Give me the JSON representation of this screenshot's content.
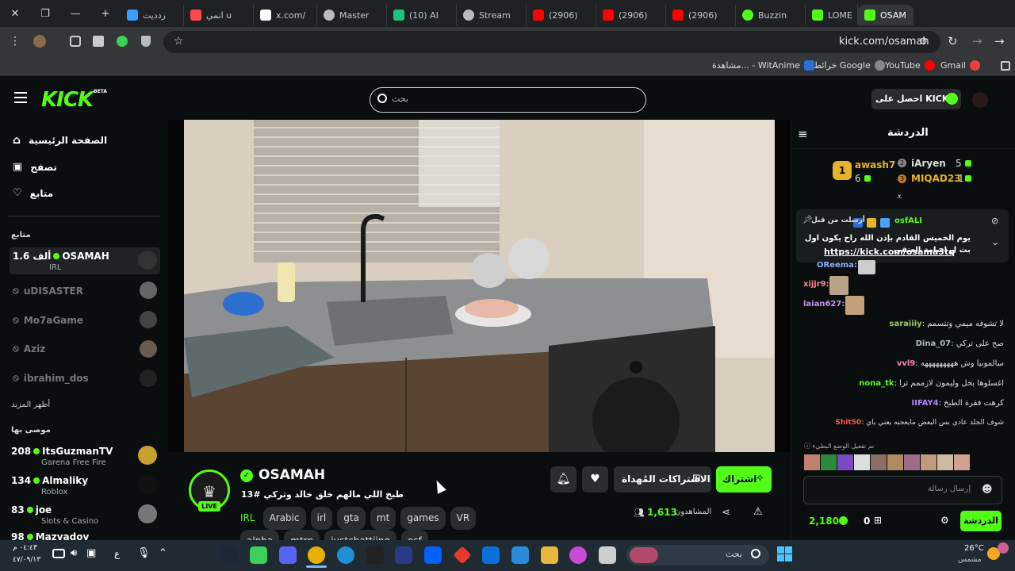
{
  "browser": {
    "tabs": [
      {
        "label": "ردديت",
        "color": "#3aa0ff"
      },
      {
        "label": "انمي u",
        "color": "#ff4a4a"
      },
      {
        "label": "x.com/",
        "color": "#ffffff"
      },
      {
        "label": "Master",
        "color": "#bbbbbb"
      },
      {
        "label": "(10) AI",
        "color": "#19c37d"
      },
      {
        "label": "Stream",
        "color": "#bbbbbb"
      },
      {
        "label": "(2906)",
        "color": "#ff0000"
      },
      {
        "label": "(2906)",
        "color": "#ff0000"
      },
      {
        "label": "(2906)",
        "color": "#ff0000"
      },
      {
        "label": "Buzzin",
        "color": "#53fc18"
      },
      {
        "label": "LOME",
        "color": "#53fc18"
      },
      {
        "label": "OSAM",
        "color": "#53fc18"
      }
    ],
    "url": "kick.com/osamah",
    "bookmarks": [
      {
        "label": "Gmail",
        "color": "#ea4335"
      },
      {
        "label": "YouTube",
        "color": "#ff0000"
      },
      {
        "label": "خرائط Google",
        "color": "#34a853"
      },
      {
        "label": "مشاهدة... - WitAnime",
        "color": "#2b6fd6"
      }
    ]
  },
  "header": {
    "logo": "KICK",
    "beta": "BETA",
    "search_placeholder": "بحث",
    "get_kicks": "احصل على KICKs"
  },
  "sidebar": {
    "nav": [
      {
        "label": "الصفحة الرئيسية"
      },
      {
        "label": "تصفح"
      },
      {
        "label": "متابع"
      }
    ],
    "following_title": "متابع",
    "following": [
      {
        "name": "OSAMAH",
        "viewers": "1.6 ألف",
        "category": "IRL",
        "live": true
      },
      {
        "name": "uDISASTER"
      },
      {
        "name": "Mo7aGame"
      },
      {
        "name": "Aziz"
      },
      {
        "name": "ibrahim_dos"
      }
    ],
    "show_more": "أظهر المزيد",
    "recommended_title": "موصى بها",
    "recommended": [
      {
        "name": "ItsGuzmanTV",
        "viewers": "208",
        "category": "Garena Free Fire"
      },
      {
        "name": "Almaliky",
        "viewers": "134",
        "category": "Roblox"
      },
      {
        "name": "joe",
        "viewers": "83",
        "category": "Slots & Casino"
      },
      {
        "name": "Mazvadov",
        "viewers": "98",
        "category": ""
      }
    ]
  },
  "stream": {
    "streamer": "OSAMAH",
    "title": "طبخ اللي مالهم خلق خالد وتركي #13",
    "live_badge": "LIVE",
    "tags": [
      "IRL",
      "Arabic",
      "irl",
      "gta",
      "mt",
      "games",
      "VR",
      "alpha",
      "mtrp",
      "justchattiing",
      "osf"
    ],
    "viewers_label": "المشاهدون",
    "viewers_count": "1,613",
    "subscribe": "اشتراك",
    "gift_subs": "الاشتراكات المُهداة"
  },
  "chat": {
    "title": "الدردشة",
    "leaderboard": [
      {
        "rank": "1",
        "name": "awash7",
        "count": "6"
      },
      {
        "rank": "2",
        "name": "iAryen",
        "count": "5"
      },
      {
        "rank": "3",
        "name": "MIQAD23",
        "count": "1"
      }
    ],
    "pinned_by": "أرسلت من قبل",
    "pinned_user": "osfALI",
    "pinned_text": "يوم الخميس القادم بإذن الله راح يكون اول بث ل اسامة العتقي",
    "pinned_link": "https://kick.com/osama3tq",
    "messages": [
      {
        "user": "OReema",
        "text": "",
        "color": "#8ab4ff"
      },
      {
        "user": "xijjr9",
        "text": "",
        "color": "#ff8a8a"
      },
      {
        "user": "laian627",
        "text": "",
        "color": "#c792ea"
      },
      {
        "user": "saraiiiy",
        "text": "لا تشوفه ميمي وتتسمم",
        "color": "#9ccc65"
      },
      {
        "user": "Dina_07",
        "text": "صح على تركي",
        "color": "#b0bec5"
      },
      {
        "user": "vvl9",
        "text": "سالمونيا وش هههههههههه",
        "color": "#ff80ab"
      },
      {
        "user": "nona_tk",
        "text": "اغسلوها بخل وليمون لازممم ترا",
        "color": "#53fc18"
      },
      {
        "user": "IIFAY4",
        "text": "كرهت فقرة الطبخ",
        "color": "#b388ff"
      },
      {
        "user": "Shit50",
        "text": "شوف الجلد عادي بس البعض مايعجبه يعني ياي",
        "color": "#ff5252"
      }
    ],
    "quick_mode": "تم تفعيل الوضع البطيء",
    "input_placeholder": "إرسال رسالة",
    "send_button": "الدردشة",
    "points": "2,180",
    "zero": "0"
  },
  "taskbar": {
    "weather": "26°C",
    "weather_desc": "مشمس",
    "time": "٠٤:٤٣ م",
    "date": "٤٧/٠٩/١٣",
    "lang": "ع",
    "search_label": "بحث"
  },
  "colors": {
    "accent": "#53fc18",
    "bg": "#0b0e0f"
  }
}
